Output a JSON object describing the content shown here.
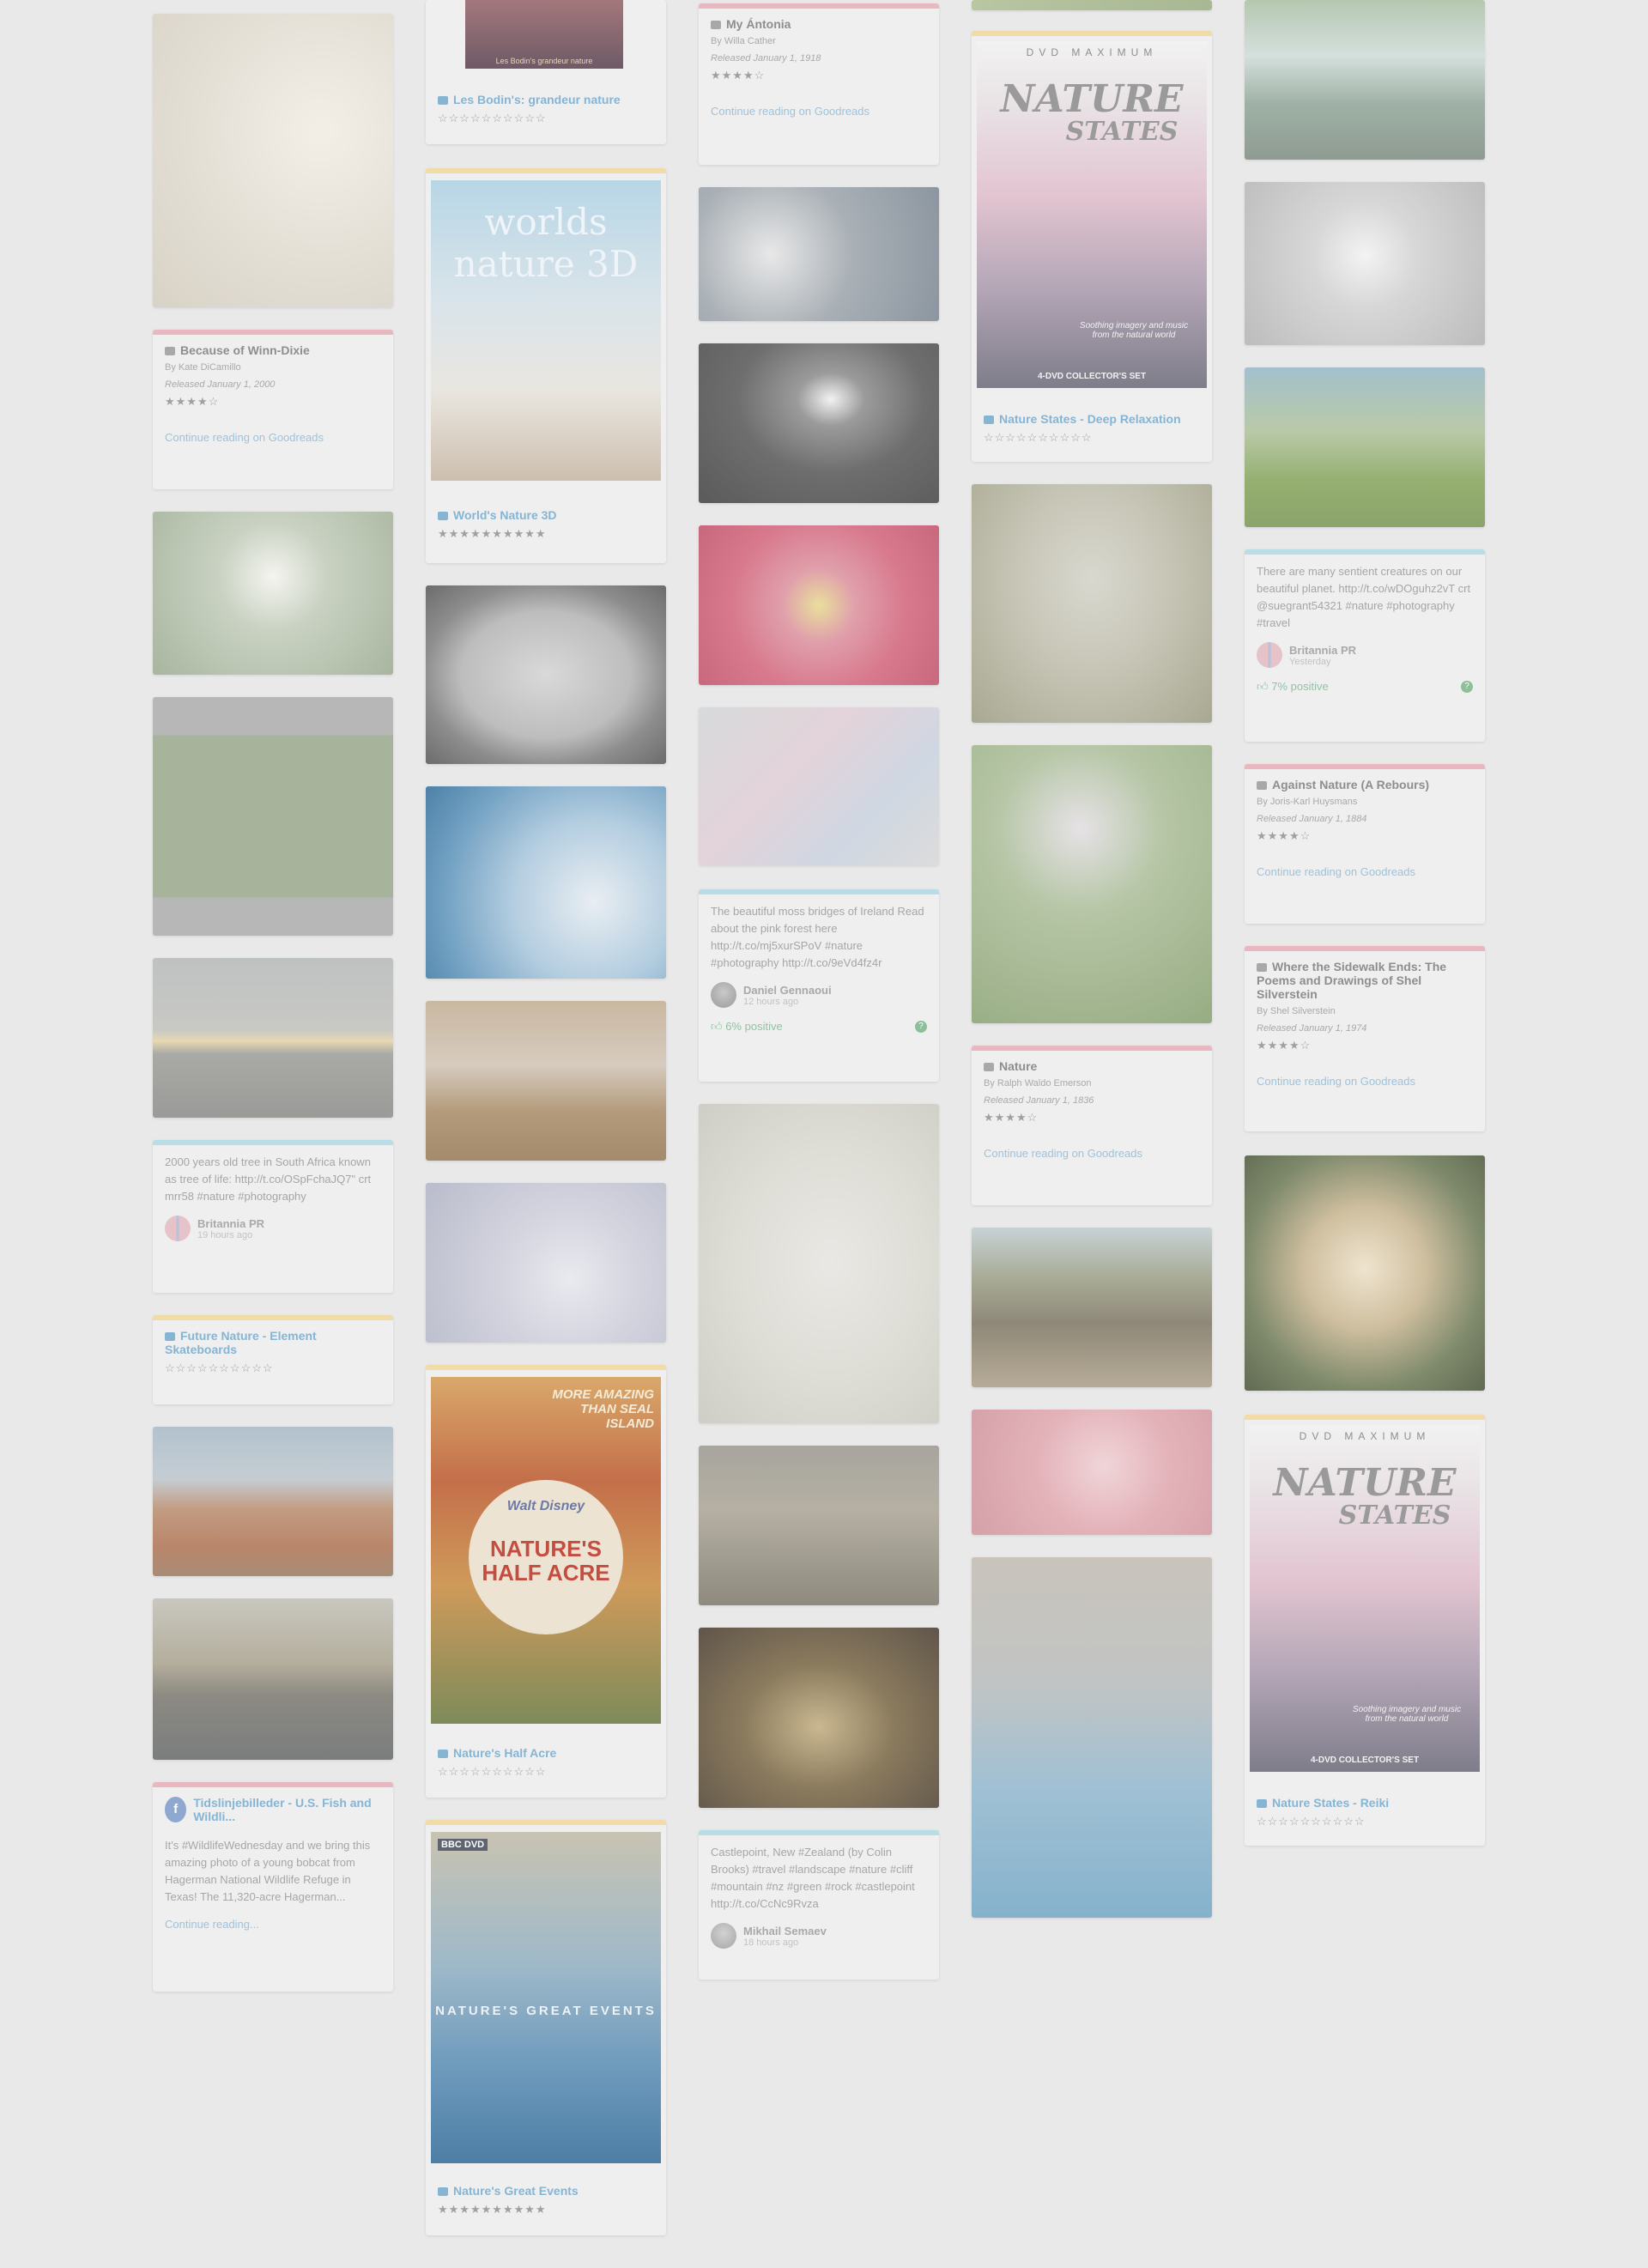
{
  "col1": {
    "book_winn": {
      "title": "Because of Winn-Dixie",
      "author": "By Kate DiCamillo",
      "released": "Released January 1, 2000",
      "stars": "★★★★☆",
      "link": "Continue reading on Goodreads"
    },
    "tweet_tree": {
      "text": "2000 years old tree in South Africa known as tree of life: http://t.co/OSpFchaJQ7\" crt mrr58 #nature #photography",
      "user": "Britannia PR",
      "time": "19 hours ago"
    },
    "video_future": {
      "title": "Future Nature - Element Skateboards",
      "stars": "☆☆☆☆☆☆☆☆☆☆"
    },
    "fb_post": {
      "title": "Tidslinjebilleder - U.S. Fish and Wildli...",
      "text": "It's #WildlifeWednesday and we bring this amazing photo of a young bobcat from Hagerman National Wildlife Refuge in Texas! The 11,320-acre Hagerman...",
      "link": "Continue reading..."
    }
  },
  "col2": {
    "video_bodins": {
      "caption": "Les Bodin's grandeur nature",
      "title": "Les Bodin's: grandeur nature",
      "stars": "☆☆☆☆☆☆☆☆☆☆"
    },
    "video_worlds": {
      "cover_title": "worlds nature 3D",
      "title": "World's Nature 3D",
      "stars": "★★★★★★★★★★"
    },
    "video_half_acre": {
      "cover_title": "NATURE'S HALF ACRE",
      "cover_top": "MORE AMAZING THAN SEAL ISLAND",
      "cover_brand": "Walt Disney",
      "title": "Nature's Half Acre",
      "stars": "☆☆☆☆☆☆☆☆☆☆"
    },
    "video_great_events": {
      "cover_brand": "BBC DVD",
      "cover_title": "NATURE'S GREAT EVENTS",
      "title": "Nature's Great Events",
      "stars": "★★★★★★★★★★"
    }
  },
  "col3": {
    "book_antonia": {
      "title": "My Ántonia",
      "author": "By Willa Cather",
      "released": "Released January 1, 1918",
      "stars": "★★★★☆",
      "link": "Continue reading on Goodreads"
    },
    "tweet_moss": {
      "text": "The beautiful moss bridges of Ireland Read about the pink forest here http://t.co/mj5xurSPoV #nature #photography http://t.co/9eVd4fz4r",
      "user": "Daniel Gennaoui",
      "time": "12 hours ago",
      "positive": "6% positive"
    },
    "tweet_castle": {
      "text": "Castlepoint, New #Zealand (by Colin Brooks) #travel #landscape #nature #cliff #mountain #nz #green #rock #castlepoint http://t.co/CcNc9Rvza",
      "user": "Mikhail Semaev",
      "time": "18 hours ago"
    }
  },
  "col4": {
    "video_states_deep": {
      "cover_brand": "DVD MAXIMUM",
      "cover_title1": "NATURE",
      "cover_title2": "STATES",
      "cover_sub": "Soothing imagery and music from the natural world",
      "cover_set": "4-DVD COLLECTOR'S SET",
      "title": "Nature States - Deep Relaxation",
      "stars": "☆☆☆☆☆☆☆☆☆☆"
    },
    "book_nature": {
      "title": "Nature",
      "author": "By Ralph Waldo Emerson",
      "released": "Released January 1, 1836",
      "stars": "★★★★☆",
      "link": "Continue reading on Goodreads"
    }
  },
  "col5": {
    "tweet_sentient": {
      "text": "There are many sentient creatures on our beautiful planet. http://t.co/wDOguhz2vT crt @suegrant54321 #nature #photography #travel",
      "user": "Britannia PR",
      "time": "Yesterday",
      "positive": "7% positive"
    },
    "book_against": {
      "title": "Against Nature (A Rebours)",
      "author": "By Joris-Karl Huysmans",
      "released": "Released January 1, 1884",
      "stars": "★★★★☆",
      "link": "Continue reading on Goodreads"
    },
    "book_sidewalk": {
      "title": "Where the Sidewalk Ends: The Poems and Drawings of Shel Silverstein",
      "author": "By Shel Silverstein",
      "released": "Released January 1, 1974",
      "stars": "★★★★☆",
      "link": "Continue reading on Goodreads"
    },
    "video_states_reiki": {
      "cover_brand": "DVD MAXIMUM",
      "cover_title1": "NATURE",
      "cover_title2": "STATES",
      "cover_sub": "Soothing imagery and music from the natural world",
      "cover_set": "4-DVD COLLECTOR'S SET",
      "title": "Nature States - Reiki",
      "stars": "☆☆☆☆☆☆☆☆☆☆"
    }
  },
  "colors": {
    "pink_bar": "#e9b7c0",
    "blue_bar": "#b8dde6",
    "yellow_bar": "#f1dca7",
    "link_blue": "#86b4d3",
    "positive_green": "#8fc3a6"
  },
  "icons": {
    "book": "book-icon",
    "video": "video-icon",
    "thumbs_up": "thumbs-up-icon",
    "help": "question-icon",
    "facebook": "facebook-icon",
    "flag": "uk-flag-icon"
  }
}
